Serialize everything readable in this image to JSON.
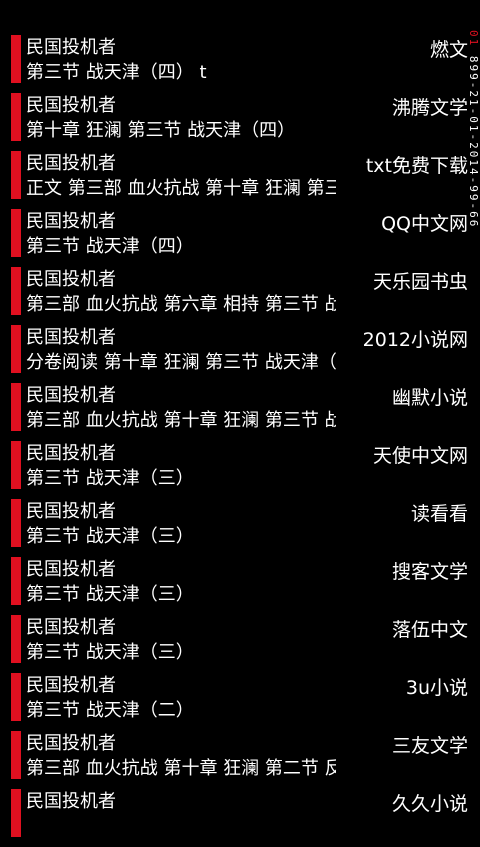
{
  "accent_color": "#e01020",
  "side_label": {
    "highlight": "01",
    "text": "899-21-01-2014-99-66"
  },
  "results": [
    {
      "title": "民国投机者",
      "chapter": "第三节 战天津（四） t",
      "source": "燃文"
    },
    {
      "title": "民国投机者",
      "chapter": "第十章 狂澜 第三节 战天津（四）",
      "source": "沸腾文学"
    },
    {
      "title": "民国投机者",
      "chapter": "正文 第三部 血火抗战 第十章 狂澜 第三",
      "source": "txt免费下载"
    },
    {
      "title": "民国投机者",
      "chapter": "第三节 战天津（四）",
      "source": "QQ中文网"
    },
    {
      "title": "民国投机者",
      "chapter": "第三部 血火抗战 第六章 相持 第三节 战",
      "source": "天乐园书虫"
    },
    {
      "title": "民国投机者",
      "chapter": "分卷阅读 第十章 狂澜 第三节 战天津（",
      "source": "2012小说网"
    },
    {
      "title": "民国投机者",
      "chapter": "第三部 血火抗战 第十章 狂澜 第三节 战",
      "source": "幽默小说"
    },
    {
      "title": "民国投机者",
      "chapter": "第三节 战天津（三）",
      "source": "天使中文网"
    },
    {
      "title": "民国投机者",
      "chapter": "第三节 战天津（三）",
      "source": "读看看"
    },
    {
      "title": "民国投机者",
      "chapter": "第三节 战天津（三）",
      "source": "搜客文学"
    },
    {
      "title": "民国投机者",
      "chapter": "第三节 战天津（三）",
      "source": "落伍中文"
    },
    {
      "title": "民国投机者",
      "chapter": "第三节 战天津（二）",
      "source": "3u小说"
    },
    {
      "title": "民国投机者",
      "chapter": "第三部 血火抗战 第十章 狂澜 第二节 反",
      "source": "三友文学"
    },
    {
      "title": "民国投机者",
      "chapter": "",
      "source": "久久小说"
    }
  ]
}
